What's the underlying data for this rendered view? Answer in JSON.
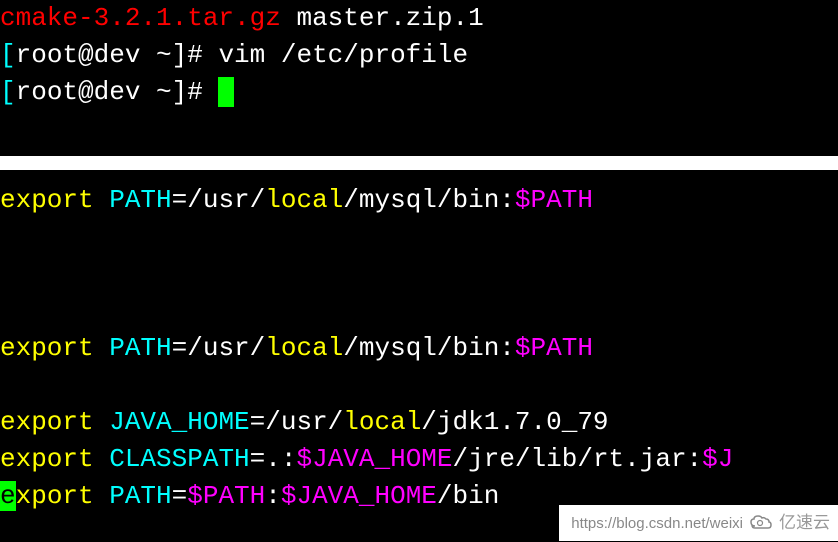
{
  "section1": {
    "line1": {
      "file1": "cmake-3.2.1.tar.gz",
      "file2": "master.zip.1"
    },
    "line2": {
      "bracket_open": "[",
      "prompt": "root@dev ~]# ",
      "command": "vim /etc/profile"
    },
    "line3": {
      "bracket_open": "[",
      "prompt": "root@dev ~]# "
    }
  },
  "section2": {
    "export_line1": {
      "pre": " ",
      "export": "export",
      "var": " PATH",
      "eq": "=",
      "path1": "/usr/",
      "local": "local",
      "path2": "/mysql/bin:",
      "pathvar": "$PATH"
    },
    "export_line2": {
      "export": "export",
      "var": " PATH",
      "eq": "=",
      "path1": "/usr/",
      "local": "local",
      "path2": "/mysql/bin:",
      "pathvar": "$PATH"
    },
    "java_home": {
      "export": "export",
      "var": " JAVA_HOME",
      "eq": "=",
      "path1": "/usr/",
      "local": "local",
      "path2": "/jdk1.7.0_79"
    },
    "classpath": {
      "export": "export",
      "var": " CLASSPATH",
      "eq": "=",
      "dot": ".:",
      "java_home": "$JAVA_HOME",
      "path2": "/jre/lib/rt.jar:",
      "j2": "$J"
    },
    "path_line": {
      "e_cursor": "e",
      "xport": "xport",
      "var": " PATH",
      "eq": "=",
      "pathvar": "$PATH",
      "colon": ":",
      "java_home": "$JAVA_HOME",
      "bin": "/bin"
    }
  },
  "watermark": {
    "url": "https://blog.csdn.net/weixi",
    "brand": "亿速云"
  }
}
